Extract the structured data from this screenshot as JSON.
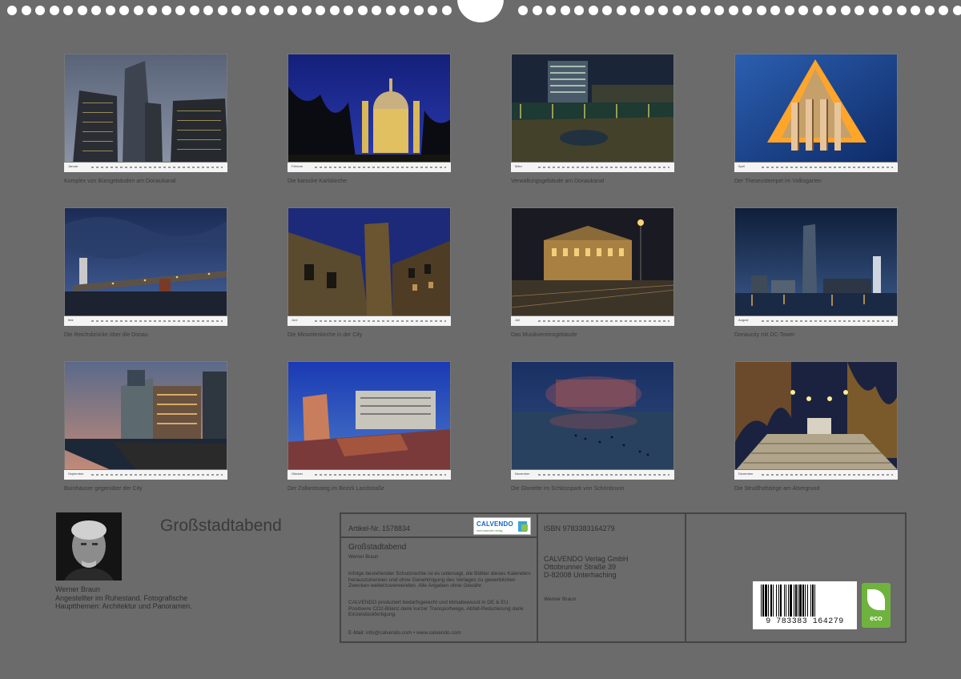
{
  "months": [
    {
      "label": "Januar",
      "caption": "Komplex von Bürogebäuden am Donaukanal"
    },
    {
      "label": "Februar",
      "caption": "Die barocke Karlskirche"
    },
    {
      "label": "März",
      "caption": "Verwaltungsgebäude am Donaukanal"
    },
    {
      "label": "April",
      "caption": "Der Theseustempel im Volksgarten"
    },
    {
      "label": "Mai",
      "caption": "Die Reichsbrücke über die Donau"
    },
    {
      "label": "Juni",
      "caption": "Die Minoritenkirche in der City"
    },
    {
      "label": "Juli",
      "caption": "Das Musikvereinsgebäude"
    },
    {
      "label": "August",
      "caption": "Donaucity mit DC-Tower"
    },
    {
      "label": "September",
      "caption": "Bürohäuser gegenüber der City"
    },
    {
      "label": "Oktober",
      "caption": "Der Zollamtssteg im Bezirk Landstraße"
    },
    {
      "label": "November",
      "caption": "Die Gloriette im Schlosspark von Schönbrunn"
    },
    {
      "label": "Dezember",
      "caption": "Die Strudlhofstiege am Alsergrund"
    }
  ],
  "author": {
    "name": "Werner Braun",
    "description": "Angestellter im Ruhestand. Fotografische Hauptthemen: Architektur und Panoramen."
  },
  "calendar_title": "Großstadtabend",
  "info": {
    "article": "Artikel-Nr. 1578834",
    "title": "Großstadtabend",
    "author": "Werner Braun",
    "legal": "Infolge bestehender Schutzrechte ist es untersagt, die Blätter dieses Kalenders herauszutrennen und ohne Genehmigung des Verlages zu gewerblichen Zwecken weiterzuverwenden. Alle Angaben ohne Gewähr.",
    "eco_text": "CALVENDO produziert bedarfsgerecht und klimabewusst in DE & EU. Positivere CO2-Bilanz dank kurzer Transportwege. Abfall-Reduzierung dank Einzelstückfertigung.",
    "contact": "E-Mail: info@calvendo.com • www.calvendo.com",
    "isbn": "ISBN 9783383164279",
    "publisher": "CALVENDO Verlag GmbH",
    "street": "Ottobrunner Straße 39",
    "city": "D-82008 Unterhaching",
    "author_small": "Werner Braun",
    "logo_text": "CALVENDO",
    "logo_sub": "mein kalender verlag",
    "barcode_number": "9 783383 164279",
    "eco_label": "eco"
  },
  "colors": {
    "background": "#6b6b6b",
    "eco_green": "#6fb23e",
    "calvendo_blue": "#1565c0"
  }
}
